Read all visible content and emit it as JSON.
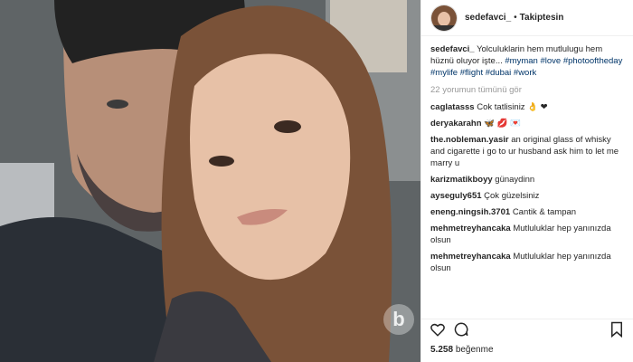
{
  "post": {
    "username": "sedefavci_",
    "separator": "•",
    "follow_status": "Takiptesin",
    "caption_user": "sedefavci_",
    "caption_text": "Yolculuklarin hem mutlulugu hem hüznü oluyor işte... ",
    "hashtags": [
      "#myman",
      "#love",
      "#photooftheday",
      "#mylife",
      "#flight",
      "#dubai",
      "#work"
    ],
    "view_all_comments": "22 yorumun tümünü gör",
    "comments": [
      {
        "user": "caglatasss",
        "text": "Cok tatlisiniz 👌 ❤"
      },
      {
        "user": "deryakarahn",
        "text": "🦋 💋 💌"
      },
      {
        "user": "the.nobleman.yasir",
        "text": "an original glass of whisky and cigarette i go to ur husband ask him to let me marry u"
      },
      {
        "user": "karizmatikboyy",
        "text": "günaydinn"
      },
      {
        "user": "ayseguly651",
        "text": "Çok güzelsiniz"
      },
      {
        "user": "eneng.ningsih.3701",
        "text": "Cantik & tampan"
      },
      {
        "user": "mehmetreyhancaka",
        "text": "Mutluluklar hep yanınızda olsun"
      },
      {
        "user": "mehmetreyhancaka",
        "text": "Mutluluklar hep yanınızda olsun"
      }
    ],
    "likes_count": "5.258",
    "likes_label": "beğenme",
    "watermark": "b"
  },
  "icons": {
    "like": "heart-outline-icon",
    "comment": "speech-bubble-icon",
    "save": "bookmark-icon"
  },
  "colors": {
    "hashtag": "#003569",
    "text": "#262626",
    "muted": "#999999"
  }
}
